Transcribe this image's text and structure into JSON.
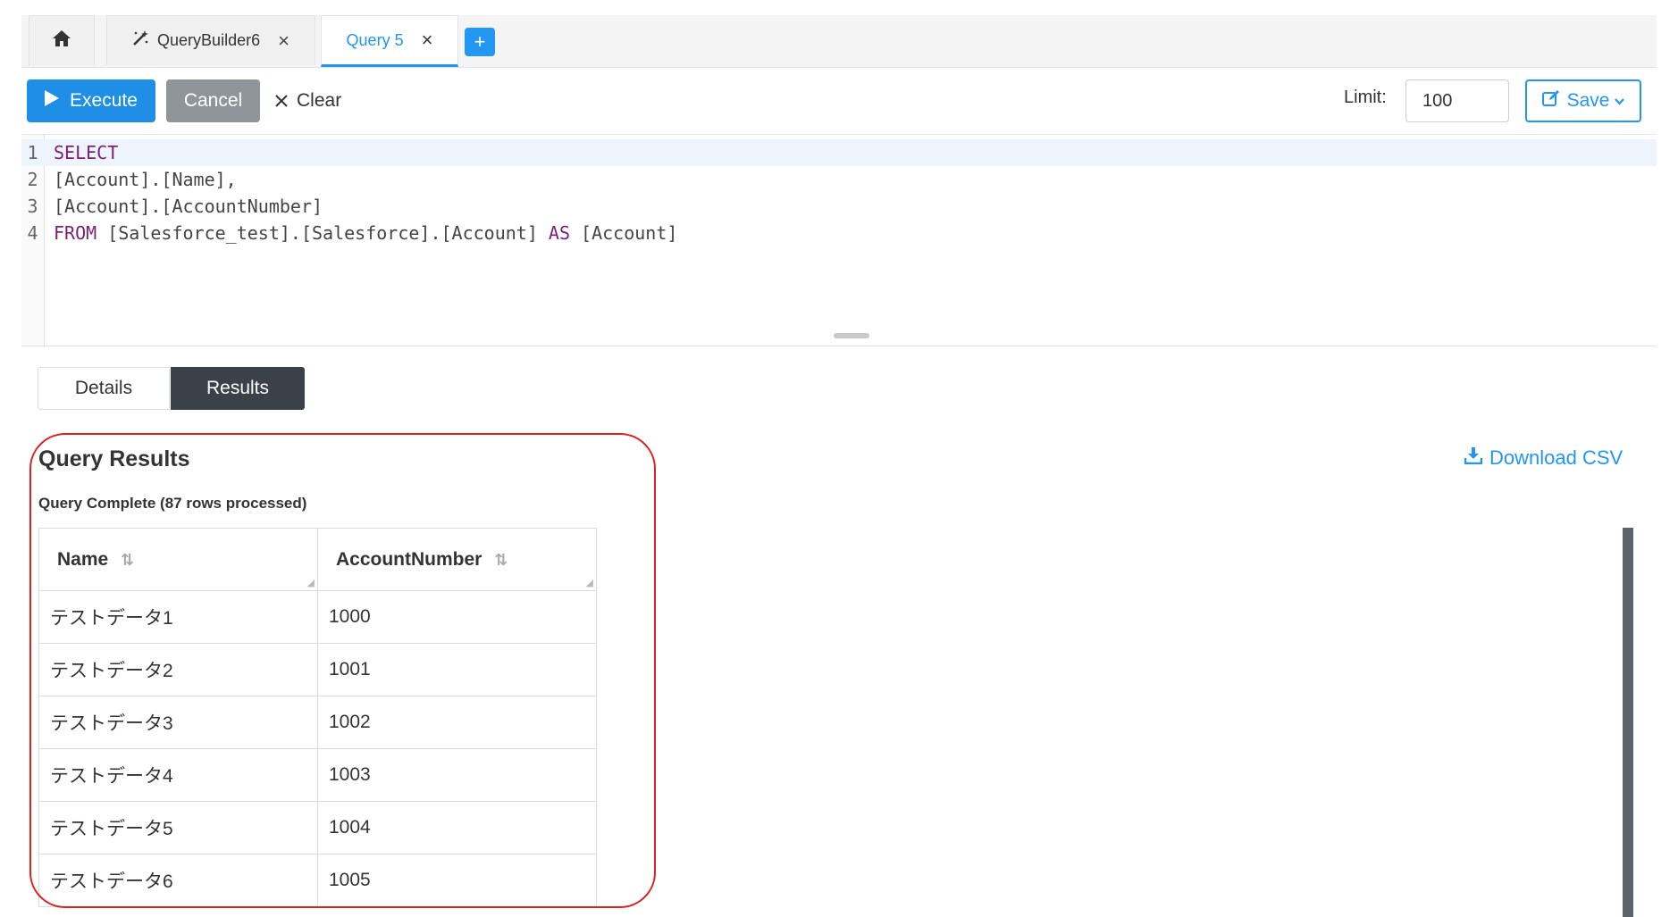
{
  "tabs": {
    "home_icon": "home-icon",
    "items": [
      {
        "label": "QueryBuilder6",
        "icon": "magic-wand-icon",
        "close": "×"
      },
      {
        "label": "Query 5",
        "close": "×"
      }
    ],
    "add_label": "+"
  },
  "toolbar": {
    "execute_label": "Execute",
    "cancel_label": "Cancel",
    "clear_label": "Clear",
    "limit_label": "Limit:",
    "limit_value": "100",
    "save_label": "Save"
  },
  "editor": {
    "lines": [
      {
        "num": "1",
        "kw1": "SELECT",
        "rest": ""
      },
      {
        "num": "2",
        "kw1": "",
        "rest": "[Account].[Name],"
      },
      {
        "num": "3",
        "kw1": "",
        "rest": "[Account].[AccountNumber]"
      },
      {
        "num": "4",
        "kw1": "FROM",
        "mid": " [Salesforce_test].[Salesforce].[Account] ",
        "kw2": "AS",
        "end": " [Account]"
      }
    ]
  },
  "result_tabs": {
    "details": "Details",
    "results": "Results"
  },
  "results": {
    "title": "Query Results",
    "status": "Query Complete (87 rows processed)",
    "download_label": "Download CSV",
    "columns": [
      "Name",
      "AccountNumber"
    ],
    "rows": [
      [
        "テストデータ1",
        "1000"
      ],
      [
        "テストデータ2",
        "1001"
      ],
      [
        "テストデータ3",
        "1002"
      ],
      [
        "テストデータ4",
        "1003"
      ],
      [
        "テストデータ5",
        "1004"
      ],
      [
        "テストデータ6",
        "1005"
      ]
    ]
  },
  "colors": {
    "accent": "#2196f3",
    "execute": "#1e8ee6",
    "cancel": "#8f959a",
    "active_tab": "#3a4149",
    "highlight": "#e02020",
    "keyword": "#7a1f7a"
  }
}
